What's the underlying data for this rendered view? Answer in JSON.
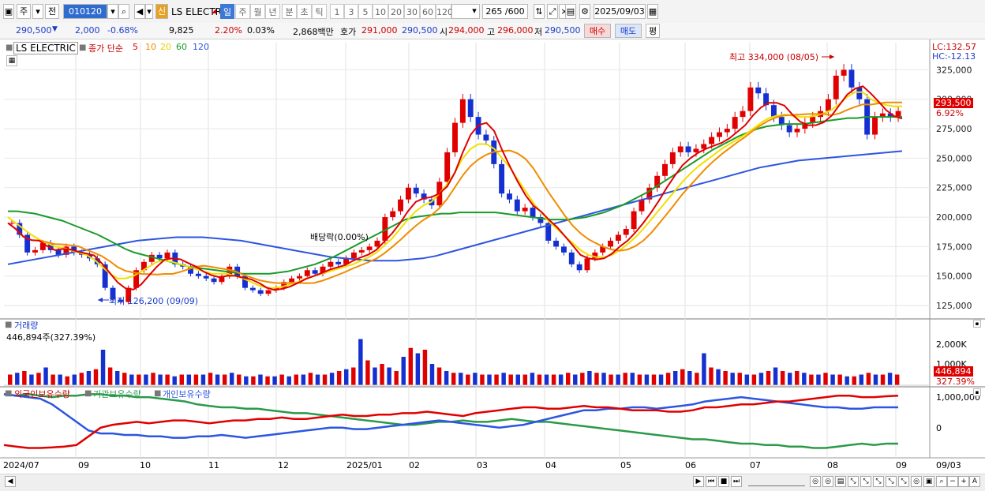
{
  "toolbar": {
    "mode_left": "주",
    "mode_second": "전",
    "code": "010120",
    "stock_name": "LS ELECTRI",
    "new_badge": "신",
    "period_tabs": [
      "일",
      "주",
      "월",
      "년",
      "분",
      "초",
      "틱"
    ],
    "number_tabs": [
      "1",
      "3",
      "5",
      "10",
      "20",
      "30",
      "60",
      "120"
    ],
    "count_display": "265 /600",
    "date": "2025/09/03"
  },
  "info": {
    "price": "290,500",
    "change": "2,000",
    "change_pct": "-0.68%",
    "volume": "9,825",
    "rate1": "2.20%",
    "rate2": "0.03%",
    "trade_value": "2,868백만",
    "quote_label": "호가",
    "bid": "291,000",
    "ask": "290,500",
    "open_label": "시",
    "open": "294,000",
    "high_label": "고",
    "high": "296,000",
    "low_label": "저",
    "low": "290,500",
    "buy_label": "매수",
    "sell_label": "매도",
    "eval_label": "평"
  },
  "legend_main": {
    "name": "LS ELECTRIC",
    "type": "종가 단순",
    "ma_5": "5",
    "ma_10": "10",
    "ma_20": "20",
    "ma_60": "60",
    "ma_120": "120"
  },
  "annotations": {
    "high_label": "최고 334,000 (08/05)",
    "low_label": "최저 126,200 (09/09)",
    "dividend": "배당락(0.00%)",
    "lc": "LC:132.57",
    "hc": "HC:-12.13",
    "price_tag": "293,500",
    "pct_tag": "6.92%"
  },
  "volume_panel": {
    "title": "거래량",
    "value": "446,894주(327.39%)",
    "tag_value": "446,894",
    "tag_pct": "327.39%",
    "axis_label": "2,000K",
    "axis_label2": "1,000K"
  },
  "holding_panel": {
    "foreign": "외국인보유수량",
    "institution": "기관보유수량",
    "individual": "개인보유수량",
    "axis_top": "1,000,000",
    "axis_zero": "0"
  },
  "bottom_axis": {
    "labels": [
      "2024/07",
      "09",
      "10",
      "11",
      "12",
      "2025/01",
      "02",
      "03",
      "04",
      "05",
      "06",
      "07",
      "08",
      "09"
    ],
    "right_label": "09/03"
  },
  "chart_data": {
    "type": "line",
    "ylim": [
      115000,
      340000
    ],
    "y_ticks": [
      125000,
      150000,
      175000,
      200000,
      225000,
      250000,
      275000,
      300000,
      325000
    ],
    "y_tick_labels": [
      "125,000",
      "150,000",
      "175,000",
      "200,000",
      "225,000",
      "250,000",
      "275,000",
      "300,000",
      "325,000"
    ],
    "close": [
      195000,
      185000,
      170000,
      172000,
      178000,
      172000,
      168000,
      175000,
      170000,
      168000,
      165000,
      160000,
      140000,
      130000,
      128000,
      140000,
      155000,
      162000,
      168000,
      165000,
      170000,
      160000,
      158000,
      152000,
      150000,
      148000,
      145000,
      150000,
      158000,
      150000,
      140000,
      138000,
      135000,
      138000,
      140000,
      145000,
      148000,
      150000,
      155000,
      152000,
      158000,
      162000,
      160000,
      165000,
      170000,
      172000,
      175000,
      180000,
      200000,
      205000,
      215000,
      225000,
      220000,
      215000,
      210000,
      230000,
      255000,
      280000,
      300000,
      285000,
      270000,
      265000,
      245000,
      220000,
      215000,
      205000,
      208000,
      200000,
      195000,
      180000,
      175000,
      170000,
      160000,
      155000,
      165000,
      170000,
      175000,
      180000,
      185000,
      190000,
      205000,
      215000,
      225000,
      235000,
      245000,
      255000,
      260000,
      255000,
      258000,
      262000,
      268000,
      272000,
      275000,
      285000,
      290000,
      310000,
      305000,
      295000,
      285000,
      278000,
      272000,
      275000,
      280000,
      285000,
      290000,
      300000,
      320000,
      325000,
      310000,
      300000,
      270000,
      285000,
      288000,
      285000,
      290000
    ],
    "ma_20": [
      200000,
      195000,
      190000,
      185000,
      181000,
      178000,
      175000,
      174000,
      172000,
      170000,
      168000,
      164000,
      158000,
      152000,
      148000,
      148000,
      150000,
      154000,
      158000,
      162000,
      163000,
      162000,
      160000,
      158000,
      156000,
      154000,
      152000,
      152000,
      152000,
      150000,
      148000,
      145000,
      142000,
      140000,
      140000,
      141000,
      143000,
      145000,
      148000,
      150000,
      152000,
      154000,
      156000,
      158000,
      160000,
      163000,
      166000,
      170000,
      176000,
      182000,
      190000,
      198000,
      205000,
      210000,
      213000,
      220000,
      228000,
      238000,
      250000,
      258000,
      262000,
      262000,
      258000,
      250000,
      242000,
      232000,
      222000,
      212000,
      204000,
      196000,
      190000,
      184000,
      178000,
      172000,
      168000,
      166000,
      166000,
      168000,
      172000,
      177000,
      183000,
      190000,
      198000,
      206000,
      214000,
      222000,
      230000,
      237000,
      243000,
      248000,
      253000,
      258000,
      262000,
      266000,
      270000,
      275000,
      280000,
      284000,
      286000,
      287000,
      286000,
      285000,
      285000,
      286000,
      288000,
      291000,
      296000,
      302000,
      306000,
      306000,
      300000,
      297000,
      295000,
      294000,
      294000
    ],
    "ma_60": [
      205000,
      205000,
      204000,
      203000,
      201000,
      199000,
      197000,
      194000,
      191000,
      188000,
      185000,
      181000,
      177000,
      173000,
      170000,
      168000,
      166000,
      164000,
      162000,
      160000,
      158000,
      157000,
      156000,
      155000,
      154000,
      153000,
      152000,
      152000,
      152000,
      152000,
      153000,
      154000,
      156000,
      158000,
      160000,
      163000,
      166000,
      170000,
      174000,
      178000,
      182000,
      186000,
      190000,
      194000,
      198000,
      200000,
      201000,
      202000,
      203000,
      203000,
      204000,
      204000,
      204000,
      204000,
      204000,
      203000,
      202000,
      201000,
      200000,
      199000,
      198000,
      198000,
      198000,
      199000,
      200000,
      202000,
      204000,
      207000,
      210000,
      214000,
      218000,
      222000,
      227000,
      232000,
      237000,
      242000,
      247000,
      252000,
      257000,
      261000,
      265000,
      269000,
      272000,
      275000,
      277000,
      278000,
      279000,
      279000,
      279000,
      280000,
      281000,
      282000,
      283000,
      284000,
      284000,
      285000,
      285000,
      285000,
      285000,
      285000
    ],
    "ma_120": [
      160000,
      162000,
      164000,
      166000,
      168000,
      170000,
      172000,
      174000,
      176000,
      178000,
      180000,
      181000,
      182000,
      183000,
      183000,
      183000,
      182000,
      181000,
      180000,
      178000,
      176000,
      174000,
      172000,
      170000,
      168000,
      166000,
      165000,
      164000,
      163000,
      163000,
      163000,
      164000,
      165000,
      167000,
      170000,
      173000,
      176000,
      179000,
      182000,
      185000,
      188000,
      191000,
      194000,
      197000,
      200000,
      203000,
      206000,
      209000,
      212000,
      215000,
      218000,
      221000,
      224000,
      227000,
      230000,
      233000,
      236000,
      239000,
      242000,
      244000,
      246000,
      248000,
      249000,
      250000,
      251000,
      252000,
      253000,
      254000,
      255000,
      256000
    ],
    "volume_relative": [
      0.3,
      0.35,
      0.4,
      0.3,
      0.35,
      0.5,
      0.3,
      0.3,
      0.25,
      0.3,
      0.35,
      0.4,
      0.45,
      1.0,
      0.5,
      0.4,
      0.35,
      0.3,
      0.3,
      0.3,
      0.35,
      0.3,
      0.3,
      0.25,
      0.3,
      0.3,
      0.3,
      0.3,
      0.35,
      0.3,
      0.3,
      0.35,
      0.3,
      0.25,
      0.25,
      0.3,
      0.25,
      0.25,
      0.3,
      0.25,
      0.3,
      0.3,
      0.35,
      0.3,
      0.3,
      0.35,
      0.4,
      0.45,
      0.5,
      1.3,
      0.7,
      0.5,
      0.6,
      0.5,
      0.4,
      0.8,
      1.05,
      0.9,
      1.0,
      0.6,
      0.5,
      0.4,
      0.35,
      0.35,
      0.3,
      0.35,
      0.3,
      0.3,
      0.3,
      0.35,
      0.3,
      0.3,
      0.3,
      0.35,
      0.3,
      0.3,
      0.3,
      0.3,
      0.35,
      0.3,
      0.35,
      0.4,
      0.35,
      0.35,
      0.3,
      0.3,
      0.35,
      0.35,
      0.3,
      0.3,
      0.3,
      0.3,
      0.35,
      0.4,
      0.45,
      0.4,
      0.35,
      0.9,
      0.5,
      0.45,
      0.4,
      0.35,
      0.35,
      0.3,
      0.3,
      0.35,
      0.4,
      0.5,
      0.4,
      0.35,
      0.4,
      0.35,
      0.3,
      0.3,
      0.35,
      0.3,
      0.3,
      0.25,
      0.25,
      0.3,
      0.35,
      0.3,
      0.3,
      0.35,
      0.3
    ],
    "foreign_holding": [
      -0.8,
      -0.85,
      -0.9,
      -0.9,
      -0.88,
      -0.85,
      -0.8,
      -0.5,
      -0.2,
      -0.1,
      -0.05,
      0.0,
      -0.05,
      0.0,
      0.05,
      0.05,
      0.0,
      -0.05,
      0.0,
      0.05,
      0.05,
      0.1,
      0.1,
      0.15,
      0.1,
      0.1,
      0.15,
      0.2,
      0.25,
      0.2,
      0.2,
      0.25,
      0.25,
      0.3,
      0.3,
      0.35,
      0.3,
      0.25,
      0.2,
      0.3,
      0.35,
      0.4,
      0.45,
      0.5,
      0.5,
      0.45,
      0.45,
      0.5,
      0.55,
      0.5,
      0.5,
      0.45,
      0.4,
      0.4,
      0.4,
      0.35,
      0.35,
      0.4,
      0.5,
      0.5,
      0.55,
      0.6,
      0.6,
      0.65,
      0.7,
      0.7,
      0.75,
      0.8,
      0.85,
      0.9,
      0.9,
      0.85,
      0.85,
      0.88,
      0.9
    ],
    "institution_holding": [
      0.95,
      0.9,
      0.95,
      0.9,
      0.85,
      0.9,
      0.9,
      0.95,
      0.95,
      0.9,
      0.9,
      0.85,
      0.85,
      0.8,
      0.75,
      0.7,
      0.6,
      0.55,
      0.5,
      0.5,
      0.45,
      0.45,
      0.4,
      0.35,
      0.3,
      0.3,
      0.25,
      0.2,
      0.15,
      0.1,
      0.05,
      0.0,
      -0.05,
      -0.1,
      -0.1,
      -0.05,
      0.0,
      0.0,
      0.05,
      0.0,
      0.0,
      0.05,
      0.1,
      0.05,
      0.0,
      0.0,
      -0.05,
      -0.1,
      -0.15,
      -0.2,
      -0.25,
      -0.3,
      -0.35,
      -0.4,
      -0.45,
      -0.5,
      -0.55,
      -0.6,
      -0.6,
      -0.65,
      -0.7,
      -0.75,
      -0.75,
      -0.8,
      -0.8,
      -0.85,
      -0.85,
      -0.9,
      -0.9,
      -0.85,
      -0.8,
      -0.75,
      -0.8,
      -0.75,
      -0.75
    ],
    "individual_holding": [
      0.95,
      0.9,
      0.85,
      0.8,
      0.6,
      0.3,
      0.0,
      -0.3,
      -0.4,
      -0.4,
      -0.45,
      -0.45,
      -0.5,
      -0.5,
      -0.55,
      -0.55,
      -0.5,
      -0.5,
      -0.45,
      -0.5,
      -0.55,
      -0.5,
      -0.45,
      -0.4,
      -0.35,
      -0.3,
      -0.25,
      -0.2,
      -0.2,
      -0.25,
      -0.25,
      -0.2,
      -0.15,
      -0.1,
      -0.05,
      0.0,
      0.05,
      0.0,
      -0.05,
      -0.1,
      -0.15,
      -0.2,
      -0.15,
      -0.1,
      0.0,
      0.1,
      0.2,
      0.3,
      0.4,
      0.4,
      0.45,
      0.45,
      0.5,
      0.5,
      0.45,
      0.5,
      0.55,
      0.6,
      0.7,
      0.75,
      0.8,
      0.85,
      0.8,
      0.75,
      0.7,
      0.65,
      0.6,
      0.55,
      0.5,
      0.5,
      0.45,
      0.45,
      0.5,
      0.5,
      0.5
    ],
    "colors": {
      "up": "#e00000",
      "down": "#1530d0",
      "ma5": "#e00000",
      "ma10": "#f08c00",
      "ma20": "#f0e000",
      "ma60": "#1a9a2a",
      "ma120": "#2d55e0",
      "foreign": "#e00000",
      "institution": "#2b9a4a",
      "individual": "#2d55e0",
      "volume_up": "#e00000",
      "volume_down": "#1530d0"
    }
  }
}
